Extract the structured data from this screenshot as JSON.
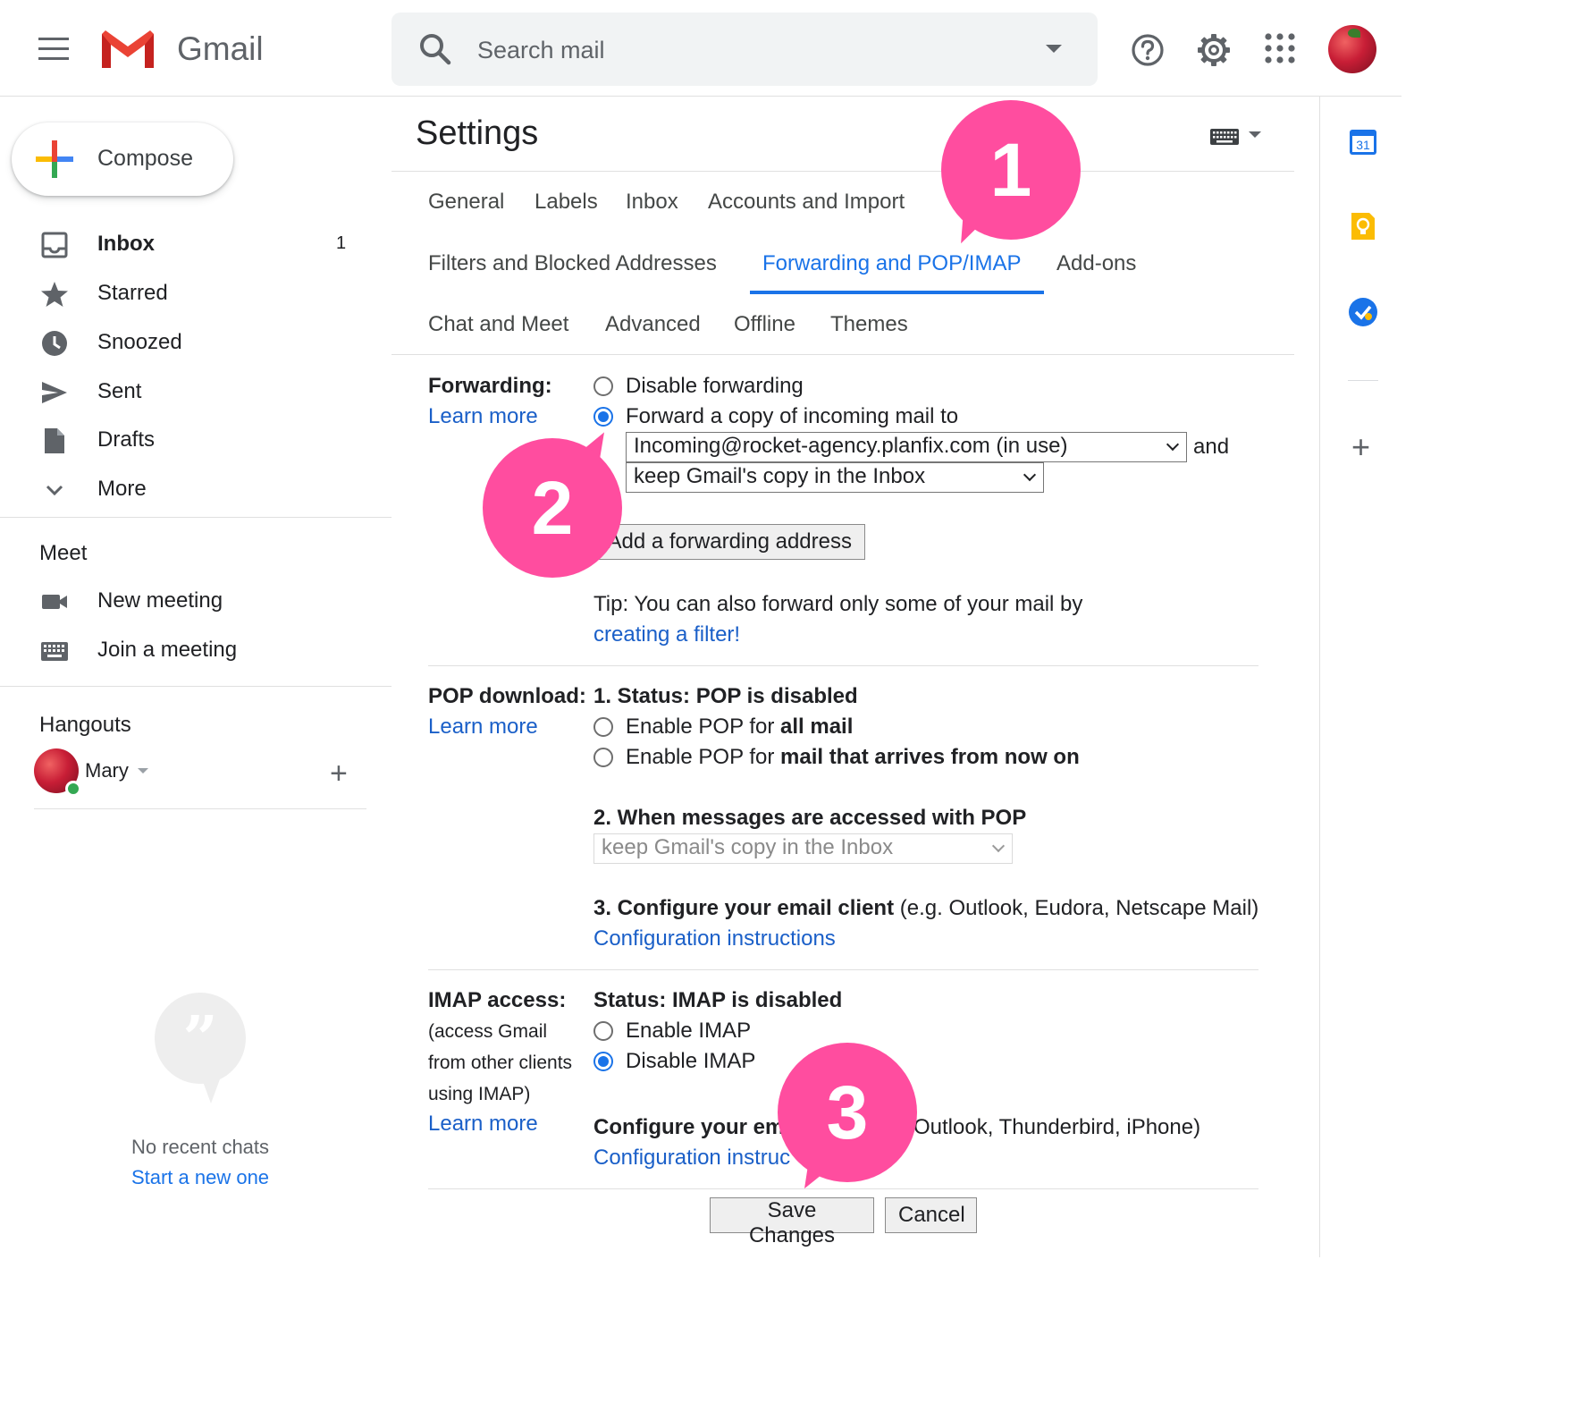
{
  "header": {
    "app_name": "Gmail",
    "search_placeholder": "Search mail"
  },
  "sidebar": {
    "compose_label": "Compose",
    "nav": [
      {
        "label": "Inbox",
        "count": "1"
      },
      {
        "label": "Starred"
      },
      {
        "label": "Snoozed"
      },
      {
        "label": "Sent"
      },
      {
        "label": "Drafts"
      },
      {
        "label": "More"
      }
    ],
    "meet": {
      "title": "Meet",
      "items": [
        {
          "label": "New meeting"
        },
        {
          "label": "Join a meeting"
        }
      ]
    },
    "hangouts": {
      "title": "Hangouts",
      "user_name": "Mary",
      "no_chats": "No recent chats",
      "start_new": "Start a new one"
    }
  },
  "right_panel": {
    "calendar_day": "31"
  },
  "settings": {
    "title": "Settings",
    "tabs": [
      {
        "label": "General"
      },
      {
        "label": "Labels"
      },
      {
        "label": "Inbox"
      },
      {
        "label": "Accounts and Import"
      },
      {
        "label": "Filters and Blocked Addresses"
      },
      {
        "label": "Forwarding and POP/IMAP",
        "active": true
      },
      {
        "label": "Add-ons"
      },
      {
        "label": "Chat and Meet"
      },
      {
        "label": "Advanced"
      },
      {
        "label": "Offline"
      },
      {
        "label": "Themes"
      }
    ],
    "forwarding": {
      "label": "Forwarding:",
      "learn_more": "Learn more",
      "option_disable": "Disable forwarding",
      "option_forward": "Forward a copy of incoming mail to",
      "selected_option": "forward",
      "forward_address": "Incoming@rocket-agency.planfix.com (in use)",
      "and": "and",
      "copy_action": "keep Gmail's copy in the Inbox",
      "add_address_button": "Add a forwarding address",
      "tip": "Tip: You can also forward only some of your mail by",
      "tip_link": "creating a filter!"
    },
    "pop": {
      "label": "POP download:",
      "learn_more": "Learn more",
      "status": "1. Status: POP is disabled",
      "enable_all_prefix": "Enable POP for ",
      "enable_all_bold": "all mail",
      "enable_now_prefix": "Enable POP for ",
      "enable_now_bold": "mail that arrives from now on",
      "when_accessed": "2. When messages are accessed with POP",
      "access_action": "keep Gmail's copy in the Inbox",
      "configure_bold": "3. Configure your email client",
      "configure_rest": " (e.g. Outlook, Eudora, Netscape Mail)",
      "config_link": "Configuration instructions"
    },
    "imap": {
      "label": "IMAP access:",
      "sub": [
        "(access Gmail",
        "from other clients",
        "using IMAP)"
      ],
      "learn_more": "Learn more",
      "status": "Status: IMAP is disabled",
      "enable": "Enable IMAP",
      "disable": "Disable IMAP",
      "selected_option": "disable",
      "configure_bold_visible": "Configure your ema",
      "configure_rest_visible": "Outlook, Thunderbird, iPhone)",
      "config_link_visible": "Configuration instruc"
    },
    "save_button": "Save Changes",
    "cancel_button": "Cancel"
  },
  "annotations": [
    {
      "number": "1"
    },
    {
      "number": "2"
    },
    {
      "number": "3"
    }
  ],
  "colors": {
    "accent": "#1a73e8",
    "link": "#1a5fc8",
    "callout": "#ff4d9f",
    "online": "#34a853"
  }
}
